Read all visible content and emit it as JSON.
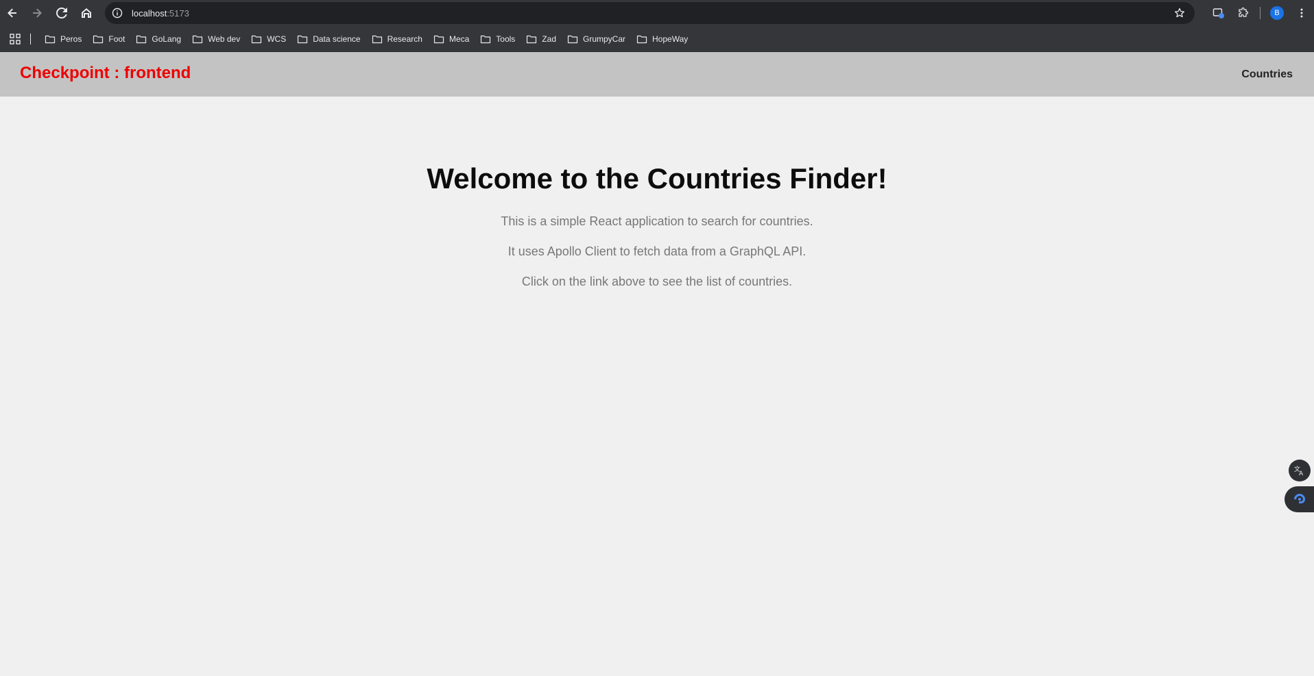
{
  "browser": {
    "url_host": "localhost",
    "url_port": ":5173",
    "avatar_letter": "B",
    "bookmarks": [
      "Peros",
      "Foot",
      "GoLang",
      "Web dev",
      "WCS",
      "Data science",
      "Research",
      "Meca",
      "Tools",
      "Zad",
      "GrumpyCar",
      "HopeWay"
    ]
  },
  "header": {
    "brand": "Checkpoint : frontend",
    "brand_color": "#ee0000",
    "nav_link": "Countries"
  },
  "main": {
    "title": "Welcome to the Countries Finder!",
    "paragraphs": [
      "This is a simple React application to search for countries.",
      "It uses Apollo Client to fetch data from a GraphQL API.",
      "Click on the link above to see the list of countries."
    ]
  }
}
